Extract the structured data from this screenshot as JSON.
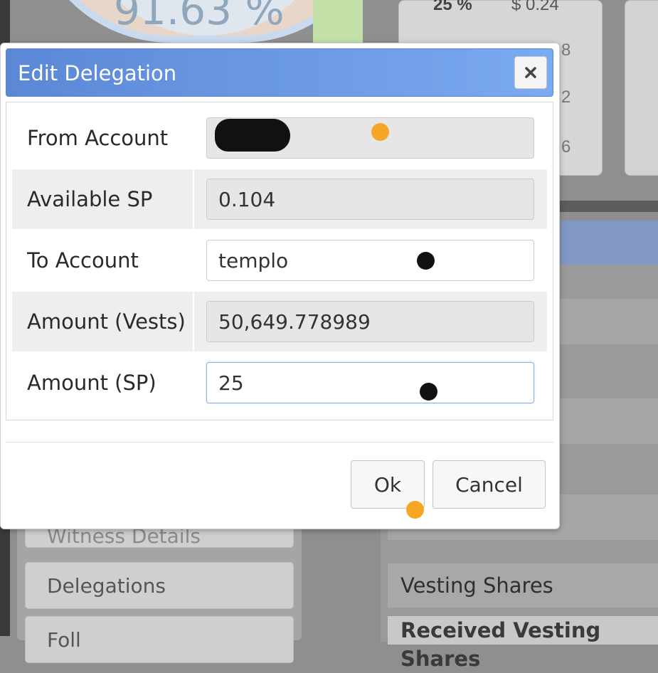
{
  "background": {
    "gauge_value": "91.63 %",
    "table_header": [
      "25 %",
      "$ 0.24"
    ],
    "table_digits": [
      "8",
      "2",
      "6"
    ],
    "menu_partial": "Witness Details",
    "menu_delegations": "Delegations",
    "menu_next_partial": "Foll",
    "vesting_label": "Vesting Shares",
    "received_label": "Received Vesting Shares"
  },
  "dialog": {
    "title": "Edit Delegation",
    "close_icon": "close-icon",
    "rows": [
      {
        "label": "From Account",
        "value": "",
        "readonly": true
      },
      {
        "label": "Available SP",
        "value": "0.104",
        "readonly": true
      },
      {
        "label": "To Account",
        "value": "templo",
        "readonly": false
      },
      {
        "label": "Amount (Vests)",
        "value": "50,649.778989",
        "readonly": true
      },
      {
        "label": "Amount (SP)",
        "value": "25",
        "readonly": false
      }
    ],
    "ok_label": "Ok",
    "cancel_label": "Cancel"
  },
  "colors": {
    "title_start": "#5b88d6",
    "title_end": "#7aaaf0",
    "marker_orange": "#f5a623",
    "marker_black": "#111111"
  }
}
